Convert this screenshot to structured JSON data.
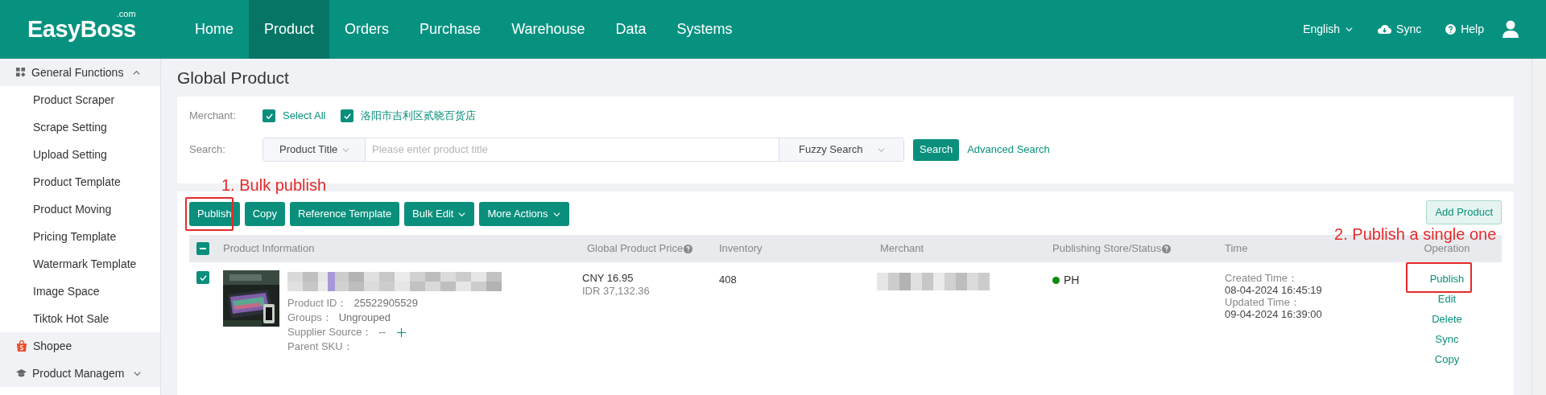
{
  "logo": {
    "text": "EasyBoss",
    "suffix": ".com"
  },
  "nav": [
    {
      "label": "Home",
      "selected": false
    },
    {
      "label": "Product",
      "selected": true
    },
    {
      "label": "Orders",
      "selected": false
    },
    {
      "label": "Purchase",
      "selected": false
    },
    {
      "label": "Warehouse",
      "selected": false
    },
    {
      "label": "Data",
      "selected": false
    },
    {
      "label": "Systems",
      "selected": false
    }
  ],
  "top_actions": [
    {
      "kind": "language",
      "label": "English"
    },
    {
      "kind": "sync",
      "label": "Sync"
    },
    {
      "kind": "help",
      "label": "Help"
    }
  ],
  "sidebar": [
    {
      "kind": "grid",
      "label": "General Functions",
      "expanded": true,
      "children": [
        "Product Scraper",
        "Scrape Setting",
        "Upload Setting",
        "Product Template",
        "Product Moving",
        "Pricing Template",
        "Watermark Template",
        "Image Space",
        "Tiktok Hot Sale"
      ]
    },
    {
      "kind": "shopee",
      "label": "Shopee"
    },
    {
      "kind": "cap",
      "label": "Product Managem",
      "expanded": false
    }
  ],
  "page_title": "Global Product",
  "filters": {
    "merchant_label": "Merchant:",
    "merchants": [
      {
        "label": "Select All",
        "checked": true
      },
      {
        "label": "洛阳市吉利区贰晓百货店",
        "checked": true
      }
    ],
    "search_label": "Search:",
    "search_by": "Product Title",
    "placeholder": "Please enter product title",
    "mode": "Fuzzy Search",
    "search_button": "Search",
    "advanced": "Advanced Search"
  },
  "toolbar": [
    {
      "label": "Publish",
      "dropdown": false,
      "annotation": "1. Bulk publish"
    },
    {
      "label": "Copy",
      "dropdown": false
    },
    {
      "label": "Reference Template",
      "dropdown": false
    },
    {
      "label": "Bulk Edit",
      "dropdown": true
    },
    {
      "label": "More Actions",
      "dropdown": true
    }
  ],
  "add_product": "Add Product",
  "table": {
    "header_checkbox": {
      "indeterminate": true
    },
    "columns": [
      {
        "label": "Product Information",
        "help": false
      },
      {
        "label": "Global Product Price",
        "help": true
      },
      {
        "label": "Inventory",
        "help": false
      },
      {
        "label": "Merchant",
        "help": false
      },
      {
        "label": "Publishing Store/Status",
        "help": true
      },
      {
        "label": "Time",
        "help": false
      },
      {
        "label": "Operation",
        "help": false
      }
    ],
    "rows": [
      {
        "checked": true,
        "fields": [
          {
            "label": "Product ID：",
            "value": "25522905529",
            "addable": false
          },
          {
            "label": "Groups：",
            "value": "Ungrouped",
            "addable": false
          },
          {
            "label": "Supplier Source：",
            "value": "--",
            "addable": true
          },
          {
            "label": "Parent SKU：",
            "addable": false
          }
        ],
        "prices": [
          "CNY 16.95",
          "IDR 37,132.36"
        ],
        "inventory": "408",
        "stores": [
          {
            "label": "PH",
            "color": "#0f8a0f"
          }
        ],
        "times": [
          {
            "label": "Created Time：",
            "value": "08-04-2024 16:45:19"
          },
          {
            "label": "Updated Time：",
            "value": "09-04-2024 16:39:00"
          }
        ],
        "operations": [
          {
            "label": "Publish",
            "annotation": "2. Publish a single one"
          },
          {
            "label": "Edit"
          },
          {
            "label": "Delete"
          },
          {
            "label": "Sync"
          },
          {
            "label": "Copy"
          }
        ]
      }
    ]
  }
}
